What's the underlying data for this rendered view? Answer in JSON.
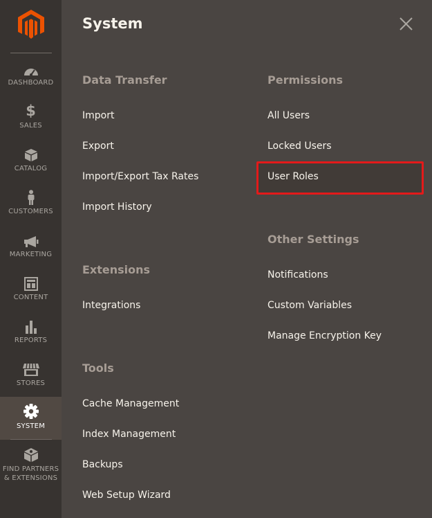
{
  "sidebar": {
    "items": [
      {
        "label": "DASHBOARD",
        "icon": "dashboard-icon"
      },
      {
        "label": "SALES",
        "icon": "dollar-icon"
      },
      {
        "label": "CATALOG",
        "icon": "box-icon"
      },
      {
        "label": "CUSTOMERS",
        "icon": "person-icon"
      },
      {
        "label": "MARKETING",
        "icon": "megaphone-icon"
      },
      {
        "label": "CONTENT",
        "icon": "layout-icon"
      },
      {
        "label": "REPORTS",
        "icon": "bar-chart-icon"
      },
      {
        "label": "STORES",
        "icon": "storefront-icon"
      },
      {
        "label": "SYSTEM",
        "icon": "gear-icon"
      },
      {
        "label_line1": "FIND PARTNERS",
        "label_line2": "& EXTENSIONS",
        "icon": "cube-icon"
      }
    ],
    "active": "SYSTEM"
  },
  "panel": {
    "title": "System",
    "data_transfer": {
      "title": "Data Transfer",
      "links": [
        "Import",
        "Export",
        "Import/Export Tax Rates",
        "Import History"
      ]
    },
    "extensions": {
      "title": "Extensions",
      "links": [
        "Integrations"
      ]
    },
    "tools": {
      "title": "Tools",
      "links": [
        "Cache Management",
        "Index Management",
        "Backups",
        "Web Setup Wizard"
      ]
    },
    "permissions": {
      "title": "Permissions",
      "links": [
        "All Users",
        "Locked Users",
        "User Roles"
      ]
    },
    "other_settings": {
      "title": "Other Settings",
      "links": [
        "Notifications",
        "Custom Variables",
        "Manage Encryption Key"
      ]
    },
    "highlighted": "User Roles"
  },
  "colors": {
    "sidebar_bg": "#373330",
    "panel_bg": "#4a4542",
    "logo_orange": "#eb5202",
    "highlight_border": "#e31a1a"
  }
}
